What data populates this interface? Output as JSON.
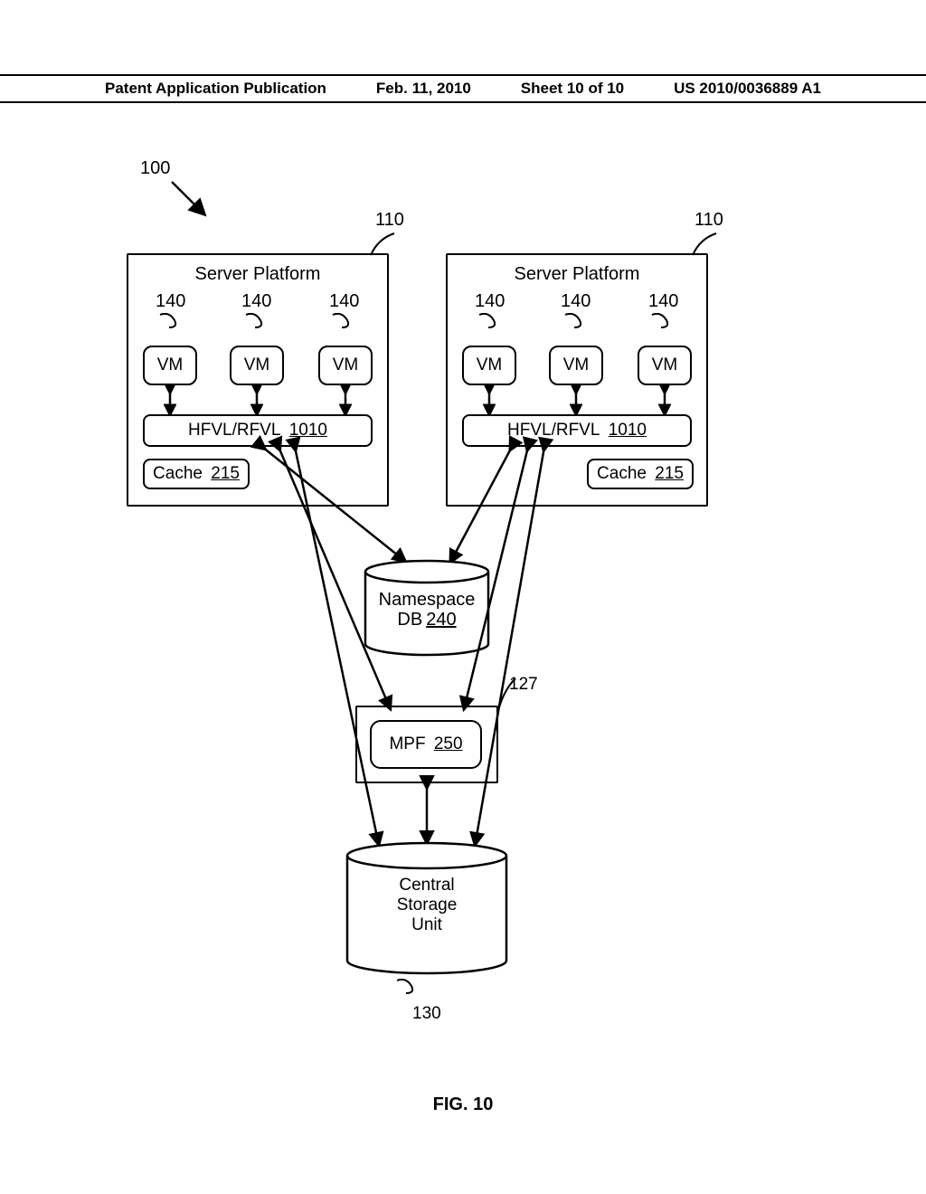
{
  "header": {
    "pub_type": "Patent Application Publication",
    "date": "Feb. 11, 2010",
    "sheet": "Sheet 10 of 10",
    "pub_no": "US 2010/0036889 A1"
  },
  "refs": {
    "r100": "100",
    "r110": "110",
    "r127": "127",
    "r130": "130",
    "r140": "140"
  },
  "servers": {
    "title": "Server Platform",
    "vm": "VM",
    "hfvl_label": "HFVL/RFVL",
    "hfvl_num": "1010",
    "cache_label": "Cache",
    "cache_num": "215"
  },
  "nsdb": {
    "line1": "Namespace",
    "line2_label": "DB",
    "line2_num": "240"
  },
  "mpf": {
    "label": "MPF",
    "num": "250"
  },
  "central": {
    "line1": "Central",
    "line2": "Storage",
    "line3": "Unit"
  },
  "figure_caption": "FIG. 10"
}
